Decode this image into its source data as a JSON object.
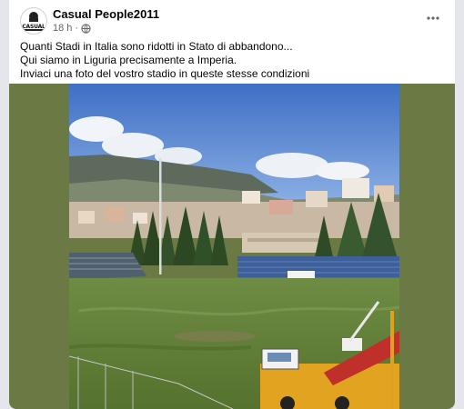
{
  "post": {
    "author": "Casual People2011",
    "time": "18 h",
    "separator": "·",
    "avatar_label": "CASUAL",
    "lines": [
      "Quanti Stadi in Italia sono ridotti in Stato di abbandono...",
      "Qui siamo in Liguria precisamente a Imperia.",
      "Inviaci una foto del vostro stadio in queste stesse condizioni"
    ]
  },
  "icons": {
    "privacy": "globe-icon",
    "options": "more-options-icon"
  },
  "colors": {
    "card_bg": "#ffffff",
    "feed_bg": "#e4e6eb",
    "media_border": "#6b7a45",
    "sky": "#4a78c8",
    "grass": "#6e8a3e"
  }
}
